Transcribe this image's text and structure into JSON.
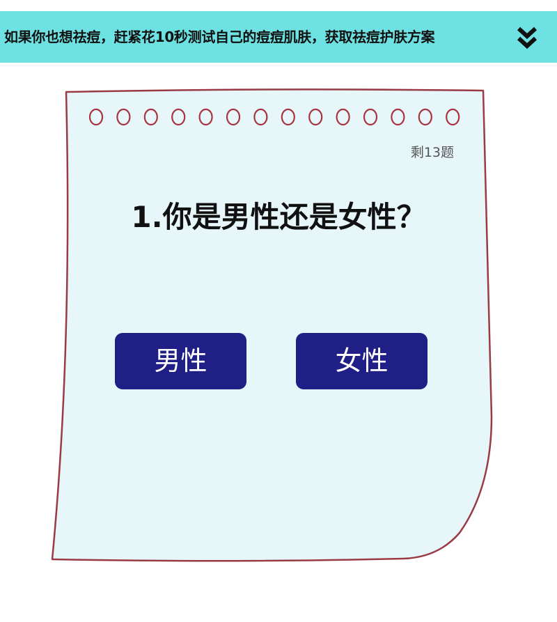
{
  "banner": {
    "text": "如果你也想祛痘，赶紧花10秒测试自己的痘痘肌肤，获取祛痘护肤方案",
    "icon": "double-chevron-down-icon",
    "background": "#6ee1e3"
  },
  "quiz": {
    "remaining": "剩13题",
    "question": "1.你是男性还是女性？",
    "options": [
      {
        "label": "男性"
      },
      {
        "label": "女性"
      }
    ],
    "option_color": "#1f1f85",
    "paper_color": "#e6f6f9",
    "border_color": "#9a3a45"
  }
}
